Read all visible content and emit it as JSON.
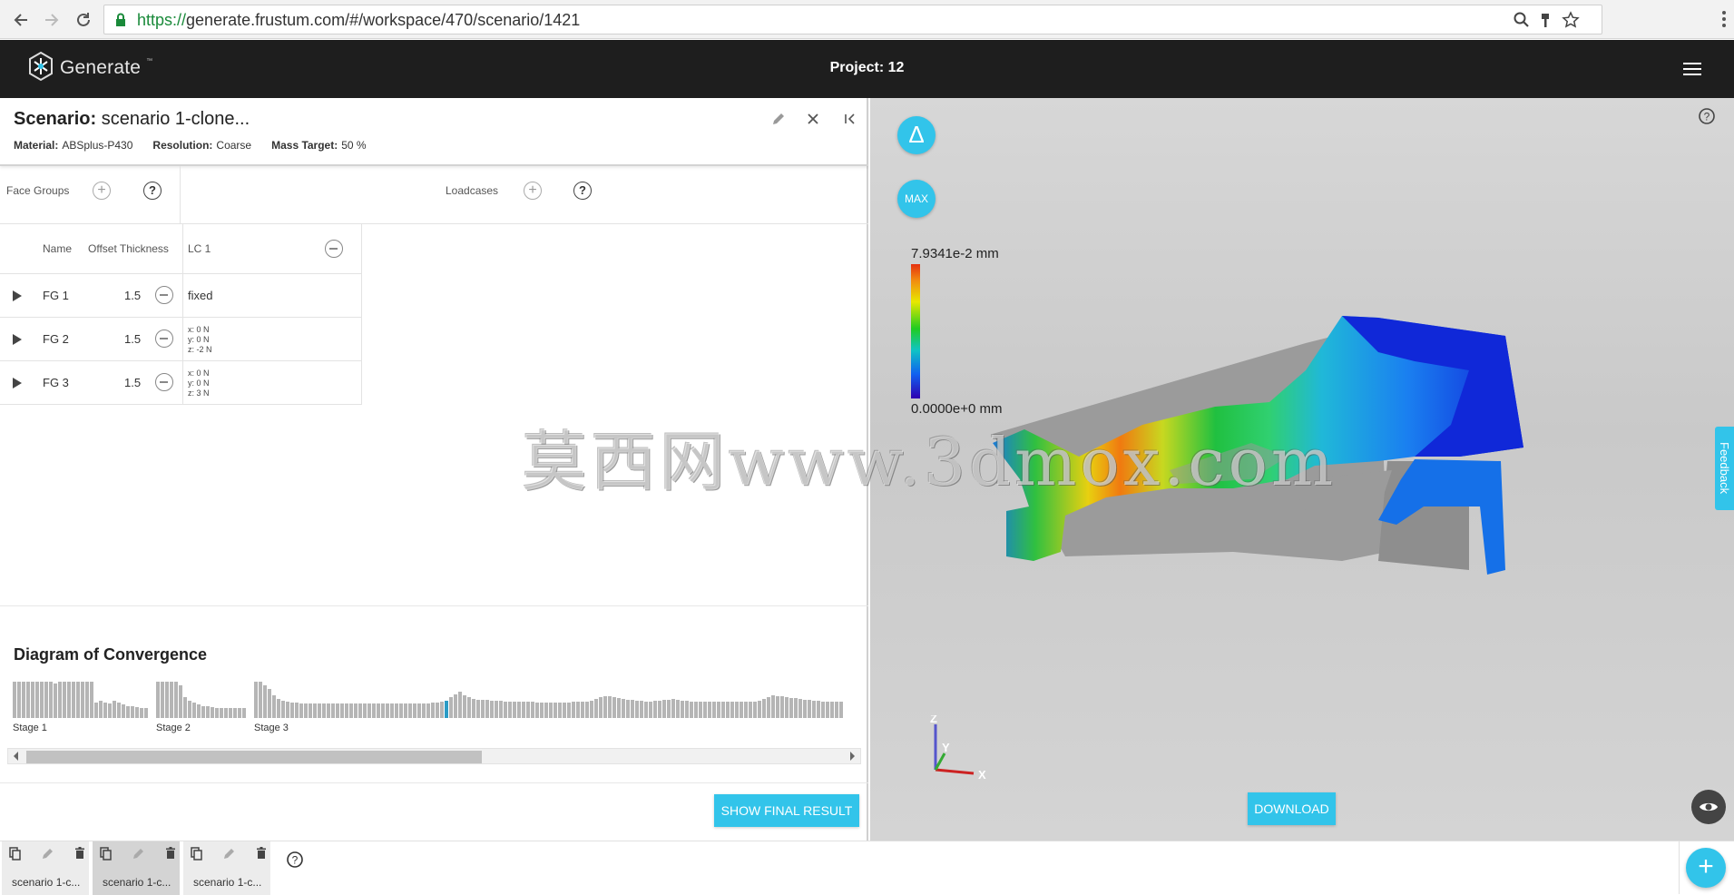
{
  "browser": {
    "url_secure": "https://",
    "url_rest": "generate.frustum.com/#/workspace/470/scenario/1421"
  },
  "header": {
    "logo_text": "Generate",
    "logo_tm": "™",
    "project_title": "Project: 12"
  },
  "scenario": {
    "title_prefix": "Scenario:",
    "title_name": "scenario 1-clone...",
    "material_label": "Material:",
    "material_value": "ABSplus-P430",
    "resolution_label": "Resolution:",
    "resolution_value": "Coarse",
    "mass_label": "Mass Target:",
    "mass_value": "50 %"
  },
  "face_groups": {
    "label": "Face Groups",
    "loadcases_label": "Loadcases",
    "add_symbol": "+",
    "help_symbol": "?"
  },
  "table": {
    "col_name": "Name",
    "col_offset": "Offset Thickness",
    "col_lc": "LC 1",
    "rows": [
      {
        "name": "FG 1",
        "offset": "1.5",
        "lc_main": "fixed",
        "lc_lines": []
      },
      {
        "name": "FG 2",
        "offset": "1.5",
        "lc_main": "",
        "lc_lines": [
          "x: 0 N",
          "y: 0 N",
          "z: -2 N"
        ]
      },
      {
        "name": "FG 3",
        "offset": "1.5",
        "lc_main": "",
        "lc_lines": [
          "x: 0 N",
          "y: 0 N",
          "z: 3 N"
        ]
      }
    ]
  },
  "convergence": {
    "title": "Diagram of Convergence",
    "stages": [
      {
        "label": "Stage 1",
        "values": [
          0.95,
          0.95,
          0.95,
          0.95,
          0.95,
          0.95,
          0.95,
          0.95,
          0.95,
          0.9,
          0.95,
          0.95,
          0.95,
          0.95,
          0.95,
          0.95,
          0.95,
          0.95,
          0.4,
          0.45,
          0.4,
          0.38,
          0.45,
          0.4,
          0.35,
          0.32,
          0.3,
          0.28,
          0.25,
          0.25
        ]
      },
      {
        "label": "Stage 2",
        "values": [
          0.95,
          0.95,
          0.95,
          0.95,
          0.95,
          0.85,
          0.55,
          0.45,
          0.4,
          0.35,
          0.3,
          0.3,
          0.28,
          0.27,
          0.26,
          0.25,
          0.25,
          0.25,
          0.25,
          0.25
        ]
      },
      {
        "label": "Stage 3",
        "values": [
          0.95,
          0.95,
          0.85,
          0.75,
          0.6,
          0.5,
          0.45,
          0.42,
          0.4,
          0.4,
          0.38,
          0.38,
          0.38,
          0.38,
          0.38,
          0.38,
          0.38,
          0.38,
          0.38,
          0.38,
          0.38,
          0.38,
          0.38,
          0.38,
          0.38,
          0.38,
          0.38,
          0.38,
          0.38,
          0.38,
          0.38,
          0.38,
          0.38,
          0.38,
          0.38,
          0.38,
          0.38,
          0.38,
          0.38,
          0.4,
          0.4,
          0.42,
          0.45,
          0.55,
          0.62,
          0.7,
          0.6,
          0.55,
          0.5,
          0.48,
          0.48,
          0.47,
          0.46,
          0.45,
          0.45,
          0.44,
          0.44,
          0.43,
          0.43,
          0.42,
          0.42,
          0.42,
          0.41,
          0.4,
          0.4,
          0.4,
          0.4,
          0.4,
          0.4,
          0.4,
          0.42,
          0.42,
          0.43,
          0.44,
          0.45,
          0.5,
          0.55,
          0.58,
          0.56,
          0.54,
          0.52,
          0.5,
          0.48,
          0.47,
          0.46,
          0.45,
          0.44,
          0.44,
          0.45,
          0.46,
          0.47,
          0.48,
          0.5,
          0.48,
          0.46,
          0.45,
          0.44,
          0.44,
          0.44,
          0.44,
          0.43,
          0.42,
          0.42,
          0.42,
          0.42,
          0.42,
          0.42,
          0.42,
          0.42,
          0.43,
          0.44,
          0.46,
          0.5,
          0.55,
          0.6,
          0.58,
          0.56,
          0.55,
          0.53,
          0.52,
          0.5,
          0.48,
          0.47,
          0.46,
          0.45,
          0.44,
          0.44,
          0.44,
          0.43,
          0.43
        ]
      }
    ],
    "highlight_stage": 2,
    "highlight_index": 42,
    "highlight_color": "#2a9bc5",
    "final_button": "SHOW FINAL RESULT"
  },
  "viewport": {
    "delta_symbol": "Δ",
    "max_label": "MAX",
    "legend_max": "7.9341e-2 mm",
    "legend_min": "0.0000e+0 mm",
    "axis_z": "Z",
    "axis_y": "Y",
    "axis_x": "X",
    "download_label": "DOWNLOAD",
    "feedback_label": "Feedback"
  },
  "watermark": "莫西网www.3dmox.com",
  "bottom": {
    "tabs": [
      {
        "label": "scenario 1-c...",
        "active": false
      },
      {
        "label": "scenario 1-c...",
        "active": true
      },
      {
        "label": "scenario 1-c...",
        "active": false
      }
    ],
    "add_symbol": "+"
  },
  "colors": {
    "accent": "#32c4ea",
    "header_bg": "#1e1e1e"
  },
  "icons": [
    "back-icon",
    "forward-icon",
    "reload-icon",
    "lock-icon",
    "zoom-icon",
    "key-icon",
    "star-icon",
    "kebab-icon",
    "logo-icon",
    "menu-icon",
    "edit-icon",
    "close-icon",
    "collapse-icon",
    "help-icon",
    "play-icon",
    "minus-icon",
    "eye-icon",
    "copy-icon",
    "delete-icon"
  ]
}
